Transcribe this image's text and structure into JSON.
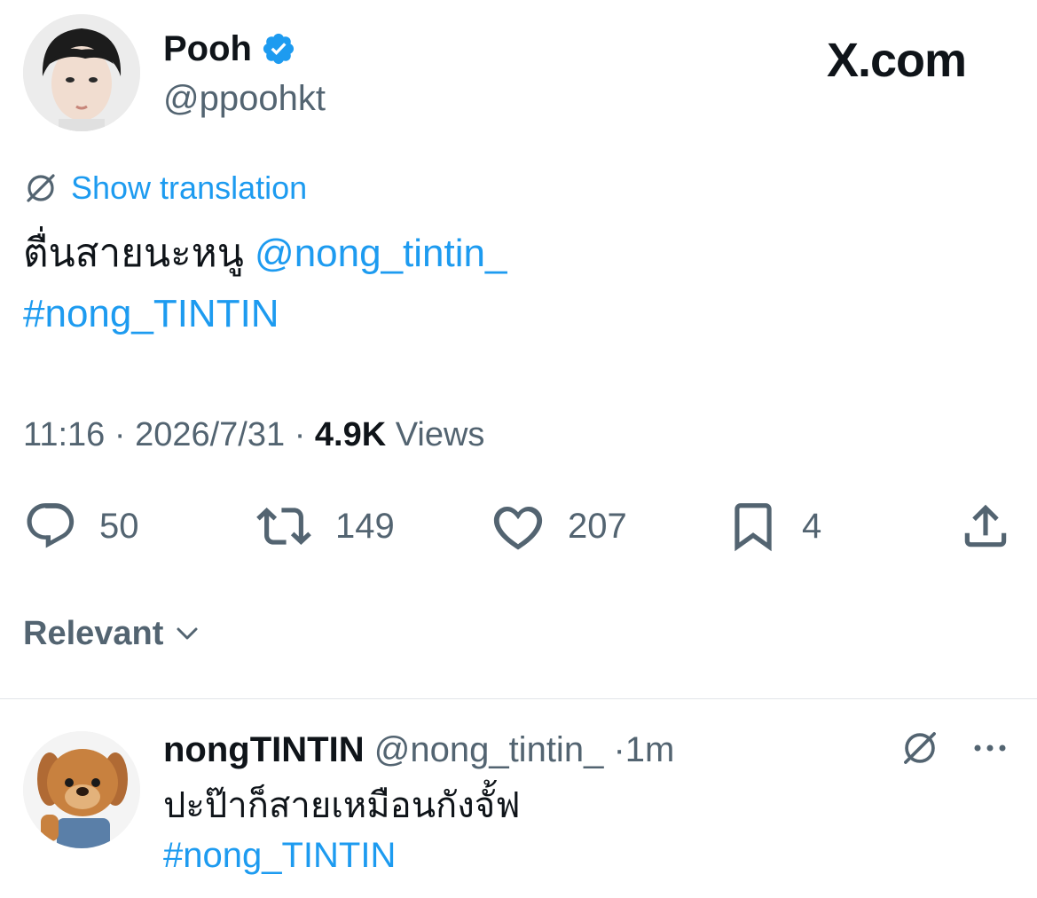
{
  "tweet": {
    "author_name": "Pooh",
    "author_handle": "@ppoohkt",
    "brand": "X.com",
    "translate_label": "Show translation",
    "text": "ตื่นสายนะหนู",
    "mention": "@nong_tintin_",
    "hashtag": "#nong_TINTIN",
    "time": "11:16",
    "date": "2026/7/31",
    "views_count": "4.9K",
    "views_label": "Views",
    "meta_separator": "·",
    "replies": "50",
    "retweets": "149",
    "likes": "207",
    "bookmarks": "4"
  },
  "sort": {
    "label": "Relevant"
  },
  "reply": {
    "author_name": "nongTINTIN",
    "author_handle": "@nong_tintin_",
    "time": "1m",
    "text": "ปะป๊าก็สายเหมือนกังจั้ฟ",
    "hashtag": "#nong_TINTIN"
  },
  "colors": {
    "accent": "#1d9bf0",
    "secondary_text": "#536471",
    "primary_text": "#0f1419"
  },
  "icons": [
    "verified-badge-icon",
    "translate-icon",
    "reply-icon",
    "retweet-icon",
    "like-icon",
    "bookmark-icon",
    "share-icon",
    "chevron-down-icon",
    "more-icon"
  ]
}
